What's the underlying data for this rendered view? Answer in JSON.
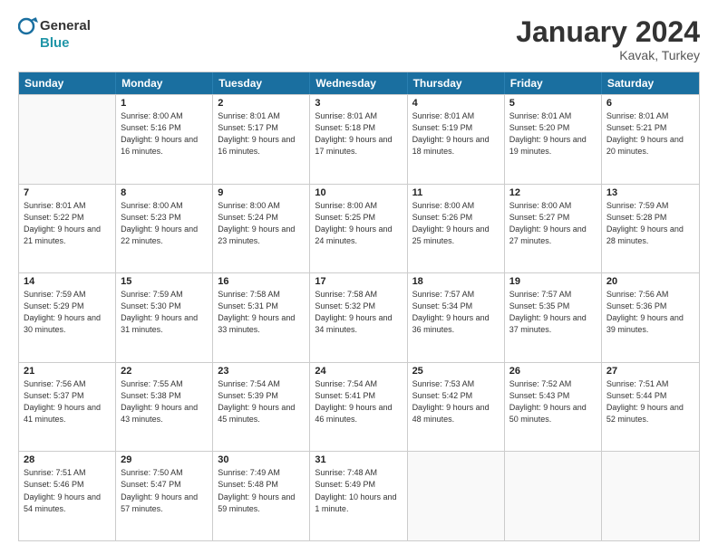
{
  "logo": {
    "line1": "General",
    "line2": "Blue"
  },
  "title": "January 2024",
  "subtitle": "Kavak, Turkey",
  "header": {
    "days": [
      "Sunday",
      "Monday",
      "Tuesday",
      "Wednesday",
      "Thursday",
      "Friday",
      "Saturday"
    ]
  },
  "weeks": [
    [
      {
        "day": "",
        "empty": true
      },
      {
        "day": "1",
        "sunrise": "8:00 AM",
        "sunset": "5:16 PM",
        "daylight": "9 hours and 16 minutes."
      },
      {
        "day": "2",
        "sunrise": "8:01 AM",
        "sunset": "5:17 PM",
        "daylight": "9 hours and 16 minutes."
      },
      {
        "day": "3",
        "sunrise": "8:01 AM",
        "sunset": "5:18 PM",
        "daylight": "9 hours and 17 minutes."
      },
      {
        "day": "4",
        "sunrise": "8:01 AM",
        "sunset": "5:19 PM",
        "daylight": "9 hours and 18 minutes."
      },
      {
        "day": "5",
        "sunrise": "8:01 AM",
        "sunset": "5:20 PM",
        "daylight": "9 hours and 19 minutes."
      },
      {
        "day": "6",
        "sunrise": "8:01 AM",
        "sunset": "5:21 PM",
        "daylight": "9 hours and 20 minutes."
      }
    ],
    [
      {
        "day": "7",
        "sunrise": "8:01 AM",
        "sunset": "5:22 PM",
        "daylight": "9 hours and 21 minutes."
      },
      {
        "day": "8",
        "sunrise": "8:00 AM",
        "sunset": "5:23 PM",
        "daylight": "9 hours and 22 minutes."
      },
      {
        "day": "9",
        "sunrise": "8:00 AM",
        "sunset": "5:24 PM",
        "daylight": "9 hours and 23 minutes."
      },
      {
        "day": "10",
        "sunrise": "8:00 AM",
        "sunset": "5:25 PM",
        "daylight": "9 hours and 24 minutes."
      },
      {
        "day": "11",
        "sunrise": "8:00 AM",
        "sunset": "5:26 PM",
        "daylight": "9 hours and 25 minutes."
      },
      {
        "day": "12",
        "sunrise": "8:00 AM",
        "sunset": "5:27 PM",
        "daylight": "9 hours and 27 minutes."
      },
      {
        "day": "13",
        "sunrise": "7:59 AM",
        "sunset": "5:28 PM",
        "daylight": "9 hours and 28 minutes."
      }
    ],
    [
      {
        "day": "14",
        "sunrise": "7:59 AM",
        "sunset": "5:29 PM",
        "daylight": "9 hours and 30 minutes."
      },
      {
        "day": "15",
        "sunrise": "7:59 AM",
        "sunset": "5:30 PM",
        "daylight": "9 hours and 31 minutes."
      },
      {
        "day": "16",
        "sunrise": "7:58 AM",
        "sunset": "5:31 PM",
        "daylight": "9 hours and 33 minutes."
      },
      {
        "day": "17",
        "sunrise": "7:58 AM",
        "sunset": "5:32 PM",
        "daylight": "9 hours and 34 minutes."
      },
      {
        "day": "18",
        "sunrise": "7:57 AM",
        "sunset": "5:34 PM",
        "daylight": "9 hours and 36 minutes."
      },
      {
        "day": "19",
        "sunrise": "7:57 AM",
        "sunset": "5:35 PM",
        "daylight": "9 hours and 37 minutes."
      },
      {
        "day": "20",
        "sunrise": "7:56 AM",
        "sunset": "5:36 PM",
        "daylight": "9 hours and 39 minutes."
      }
    ],
    [
      {
        "day": "21",
        "sunrise": "7:56 AM",
        "sunset": "5:37 PM",
        "daylight": "9 hours and 41 minutes."
      },
      {
        "day": "22",
        "sunrise": "7:55 AM",
        "sunset": "5:38 PM",
        "daylight": "9 hours and 43 minutes."
      },
      {
        "day": "23",
        "sunrise": "7:54 AM",
        "sunset": "5:39 PM",
        "daylight": "9 hours and 45 minutes."
      },
      {
        "day": "24",
        "sunrise": "7:54 AM",
        "sunset": "5:41 PM",
        "daylight": "9 hours and 46 minutes."
      },
      {
        "day": "25",
        "sunrise": "7:53 AM",
        "sunset": "5:42 PM",
        "daylight": "9 hours and 48 minutes."
      },
      {
        "day": "26",
        "sunrise": "7:52 AM",
        "sunset": "5:43 PM",
        "daylight": "9 hours and 50 minutes."
      },
      {
        "day": "27",
        "sunrise": "7:51 AM",
        "sunset": "5:44 PM",
        "daylight": "9 hours and 52 minutes."
      }
    ],
    [
      {
        "day": "28",
        "sunrise": "7:51 AM",
        "sunset": "5:46 PM",
        "daylight": "9 hours and 54 minutes."
      },
      {
        "day": "29",
        "sunrise": "7:50 AM",
        "sunset": "5:47 PM",
        "daylight": "9 hours and 57 minutes."
      },
      {
        "day": "30",
        "sunrise": "7:49 AM",
        "sunset": "5:48 PM",
        "daylight": "9 hours and 59 minutes."
      },
      {
        "day": "31",
        "sunrise": "7:48 AM",
        "sunset": "5:49 PM",
        "daylight": "10 hours and 1 minute."
      },
      {
        "day": "",
        "empty": true
      },
      {
        "day": "",
        "empty": true
      },
      {
        "day": "",
        "empty": true
      }
    ]
  ]
}
